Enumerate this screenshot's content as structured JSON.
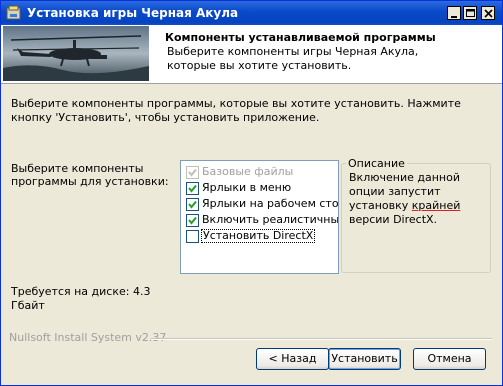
{
  "window": {
    "title": "Установка игры Черная Акула"
  },
  "header": {
    "title": "Компоненты устанавливаемой программы",
    "subtitle": "Выберите компоненты игры Черная Акула, которые вы хотите установить."
  },
  "main": {
    "description": "Выберите компоненты программы, которые вы хотите установить. Нажмите кнопку 'Установить', чтобы установить приложение.",
    "components_label": "Выберите компоненты программы для установки:",
    "components": [
      {
        "label": "Базовые файлы",
        "checked": true,
        "disabled": true
      },
      {
        "label": "Ярлыки в меню",
        "checked": true,
        "disabled": false
      },
      {
        "label": "Ярлыки на рабочем стол",
        "checked": true,
        "disabled": false
      },
      {
        "label": "Включить реалистичны",
        "checked": true,
        "disabled": false
      },
      {
        "label": "Установить DirectX",
        "checked": false,
        "disabled": false,
        "selected": true
      }
    ],
    "description_group": {
      "title": "Описание",
      "text_before": "Включение данной опции запустит установку ",
      "text_underlined": "крайней",
      "text_after": " версии DirectX."
    },
    "space_required": "Требуется на диске: 4.3 Гбайт"
  },
  "footer": {
    "branding": "Nullsoft Install System v2.37",
    "back_label": "< Назад",
    "install_label": "Установить",
    "cancel_label": "Отмена"
  },
  "colors": {
    "titlebar": "#0a49c8",
    "face": "#ece9d8",
    "check": "#21a121"
  }
}
